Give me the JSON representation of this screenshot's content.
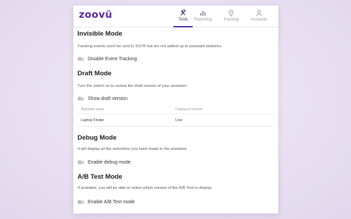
{
  "app": {
    "logo": "zoovü"
  },
  "nav": [
    {
      "label": "Tools",
      "icon": "tools-icon"
    },
    {
      "label": "Reporting",
      "icon": "chart-icon"
    },
    {
      "label": "Tracking",
      "icon": "location-pin-icon"
    },
    {
      "label": "Accounts",
      "icon": "user-icon"
    }
  ],
  "sections": {
    "invisible": {
      "title": "Invisible Mode",
      "description": "Tracking events won't be sent to SSTR but are not added up to assistant statistics.",
      "toggle_label": "Disable Event Tracking"
    },
    "draft": {
      "title": "Draft Mode",
      "description": "Turn the switch on to review the draft version of your assistant.",
      "toggle_label": "Show draft version",
      "table": {
        "headers": [
          "Assistant name",
          "Displayed version"
        ],
        "rows": [
          [
            "Laptop Finder",
            "Live"
          ]
        ]
      }
    },
    "debug": {
      "title": "Debug Mode",
      "description": "It will display all the selections you have made in the assistant.",
      "toggle_label": "Enable debug mode"
    },
    "ab": {
      "title": "A/B Test Mode",
      "description": "If available, you will be able to select which version of the A/B Test to display.",
      "toggle_label": "Enable A/B Test mode"
    }
  },
  "colors": {
    "brand": "#5a1fb0",
    "active_tab": "#4a2a9c"
  }
}
